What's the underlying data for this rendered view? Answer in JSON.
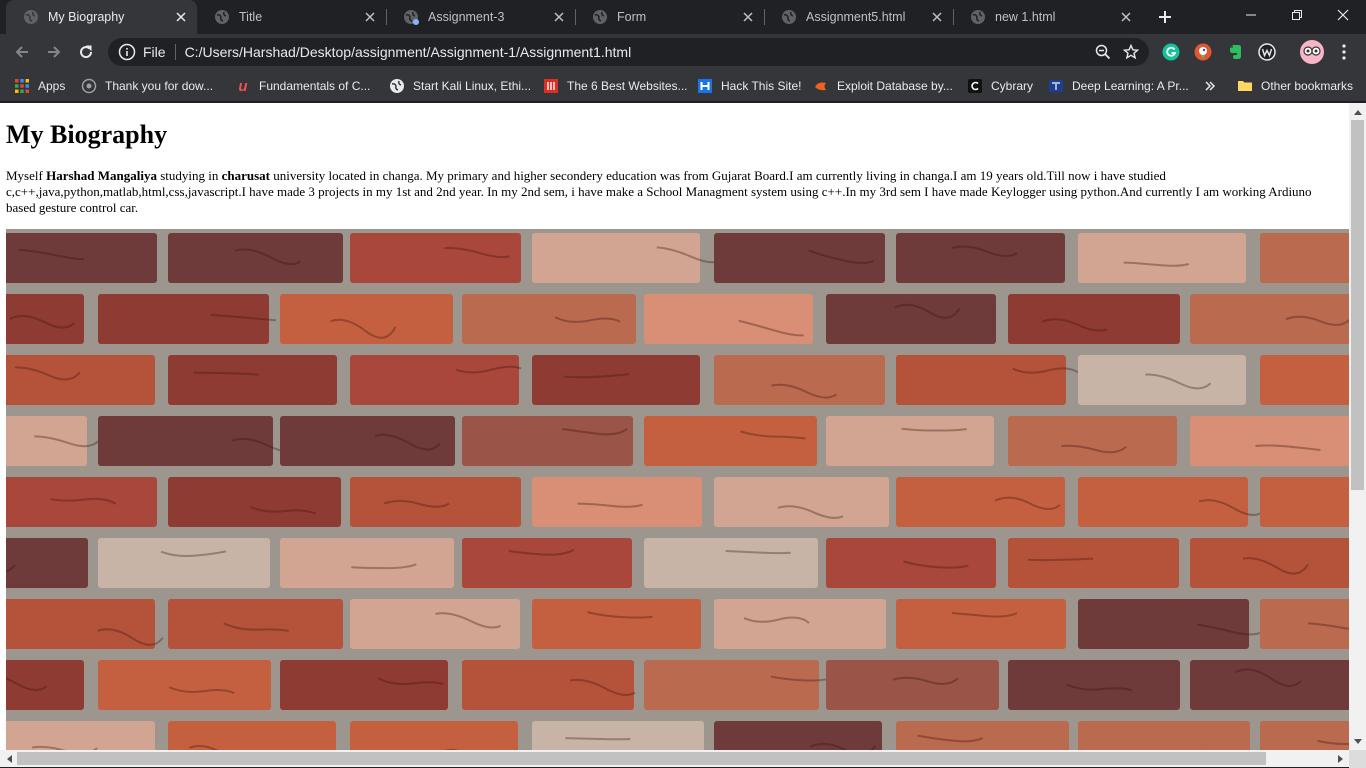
{
  "tabs": [
    {
      "title": "My Biography",
      "active": true
    },
    {
      "title": "Title",
      "active": false
    },
    {
      "title": "Assignment-3",
      "active": false
    },
    {
      "title": "Form",
      "active": false
    },
    {
      "title": "Assignment5.html",
      "active": false
    },
    {
      "title": "new 1.html",
      "active": false
    }
  ],
  "toolbar": {
    "scheme_label": "File",
    "url": "C:/Users/Harshad/Desktop/assignment/Assignment-1/Assignment1.html"
  },
  "bookmarks": [
    {
      "label": "Apps",
      "icon": "apps-grid-icon"
    },
    {
      "label": "Thank you for dow...",
      "icon": "site-icon"
    },
    {
      "label": "Fundamentals of C...",
      "icon": "udemy-icon"
    },
    {
      "label": "Start Kali Linux, Ethi...",
      "icon": "globe-icon"
    },
    {
      "label": "The 6 Best Websites...",
      "icon": "site-icon"
    },
    {
      "label": "Hack This Site!",
      "icon": "hackthissite-icon"
    },
    {
      "label": "Exploit Database by...",
      "icon": "exploit-db-icon"
    },
    {
      "label": "Cybrary",
      "icon": "cybrary-icon"
    },
    {
      "label": "Deep Learning: A Pr...",
      "icon": "book-icon"
    },
    {
      "label": "Other bookmarks",
      "icon": "folder-icon"
    }
  ],
  "page": {
    "heading": "My Biography",
    "bio": {
      "t1": "Myself ",
      "name": "Harshad Mangaliya",
      "t2": " studying in ",
      "university": "charusat",
      "t3": " university located in changa. My primary and higher secondery education was from Gujarat Board.I am currently living in changa.I am 19 years old.Till now i have studied c,c++,java,python,matlab,html,css,javascript.I have made 3 projects in my 1st and 2nd year. In my 2nd sem, i have make a School Managment system using c++.In my 3rd sem I have made Keylogger using python.And currently I am working Ardiuno based gesture control car."
    },
    "image_subject": "brick-wall"
  },
  "colors": {
    "tabstrip": "#202124",
    "toolbar": "#35363a",
    "page_bg": "#ffffff",
    "brick_mortar": "#9d968f"
  }
}
